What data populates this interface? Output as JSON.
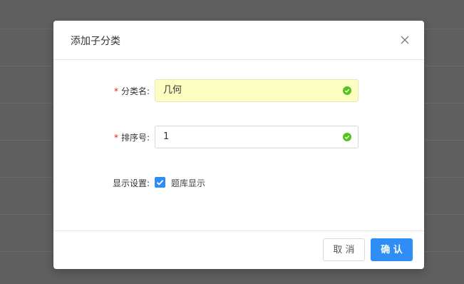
{
  "dialog": {
    "title": "添加子分类",
    "close_icon": "close-icon"
  },
  "form": {
    "category_name": {
      "label": "分类名:",
      "required": "*",
      "value": "几何"
    },
    "sort_order": {
      "label": "排序号:",
      "required": "*",
      "value": "1"
    },
    "display": {
      "label": "显示设置:",
      "checkbox_label": "题库显示",
      "checked": true
    }
  },
  "footer": {
    "cancel_label": "取 消",
    "confirm_label": "确 认"
  },
  "colors": {
    "accent": "#2f8ef5",
    "valid": "#52c41a",
    "required": "#e02020",
    "filled_bg": "#fbfdc1"
  }
}
